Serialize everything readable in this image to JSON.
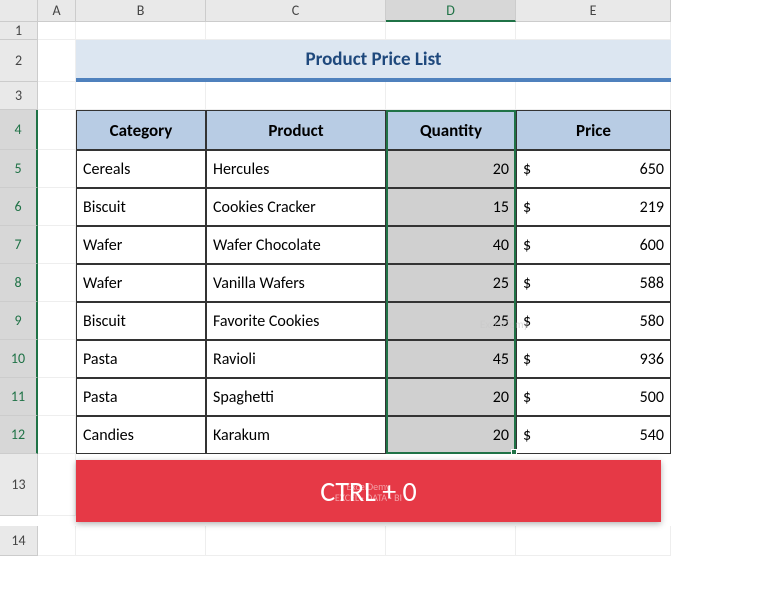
{
  "columns": [
    "A",
    "B",
    "C",
    "D",
    "E"
  ],
  "selectedColumn": "D",
  "title": "Product Price List",
  "headers": {
    "category": "Category",
    "product": "Product",
    "quantity": "Quantity",
    "price": "Price"
  },
  "currency": "$",
  "rows": [
    {
      "n": "5",
      "category": "Cereals",
      "product": "Hercules",
      "quantity": "20",
      "price": "650"
    },
    {
      "n": "6",
      "category": "Biscuit",
      "product": "Cookies Cracker",
      "quantity": "15",
      "price": "219"
    },
    {
      "n": "7",
      "category": "Wafer",
      "product": "Wafer Chocolate",
      "quantity": "40",
      "price": "600"
    },
    {
      "n": "8",
      "category": "Wafer",
      "product": "Vanilla Wafers",
      "quantity": "25",
      "price": "588"
    },
    {
      "n": "9",
      "category": "Biscuit",
      "product": "Favorite Cookies",
      "quantity": "25",
      "price": "580"
    },
    {
      "n": "10",
      "category": "Pasta",
      "product": "Ravioli",
      "quantity": "45",
      "price": "936"
    },
    {
      "n": "11",
      "category": "Pasta",
      "product": "Spaghetti",
      "quantity": "20",
      "price": "500"
    },
    {
      "n": "12",
      "category": "Candies",
      "product": "Karakum",
      "quantity": "20",
      "price": "540"
    }
  ],
  "rowLabels": {
    "r1": "1",
    "r2": "2",
    "r3": "3",
    "r4": "4",
    "r13": "13",
    "r14": "14"
  },
  "shortcut": "CTRL + 0",
  "watermark": {
    "line1": "ExcelDemy",
    "line2": "EXCEL · DATA · BI"
  }
}
